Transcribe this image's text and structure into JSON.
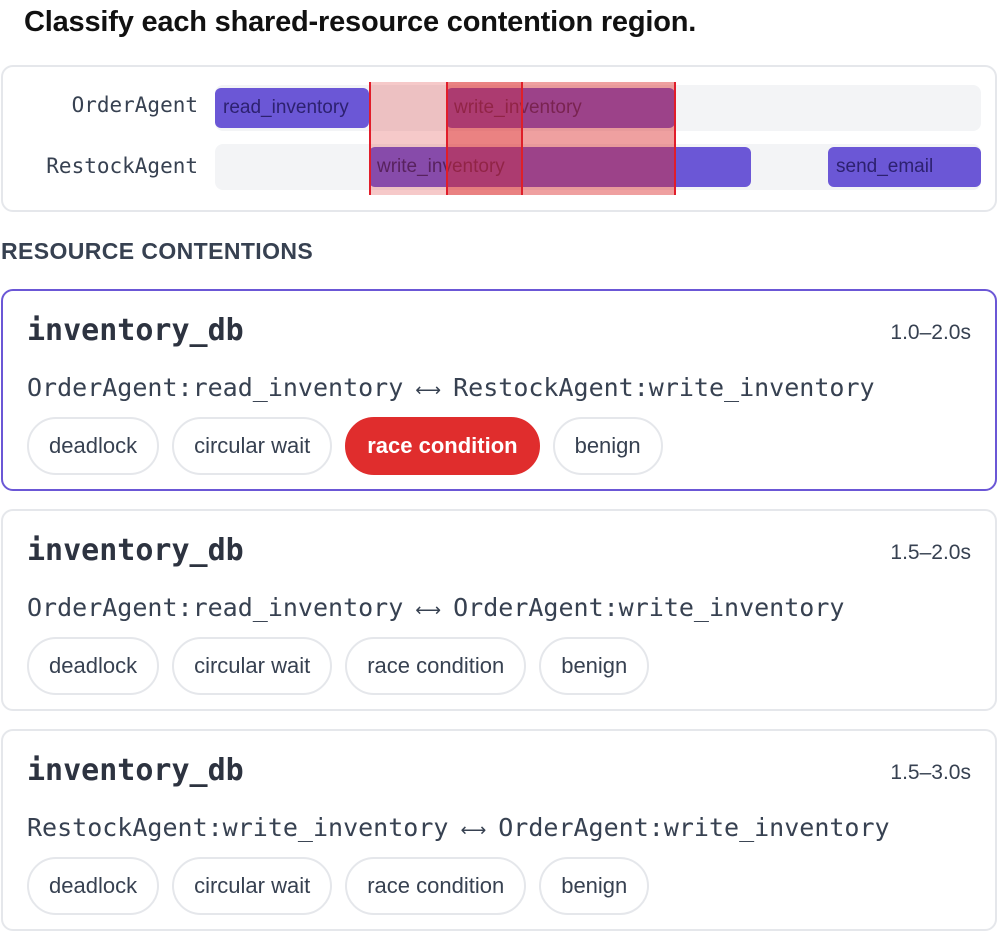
{
  "title": "Classify each shared-resource contention region.",
  "timeline": {
    "lanes": [
      {
        "label": "OrderAgent",
        "bars": [
          "read_inventory",
          "write_inventory"
        ]
      },
      {
        "label": "RestockAgent",
        "bars": [
          "write_inventory",
          "send_email"
        ]
      }
    ]
  },
  "section_heading": "RESOURCE CONTENTIONS",
  "contentions": [
    {
      "resource": "inventory_db",
      "time": "1.0–2.0s",
      "left": "OrderAgent:read_inventory",
      "arrow": "⟷",
      "right": "RestockAgent:write_inventory",
      "selected": "race condition"
    },
    {
      "resource": "inventory_db",
      "time": "1.5–2.0s",
      "left": "OrderAgent:read_inventory",
      "arrow": "⟷",
      "right": "OrderAgent:write_inventory",
      "selected": ""
    },
    {
      "resource": "inventory_db",
      "time": "1.5–3.0s",
      "left": "RestockAgent:write_inventory",
      "arrow": "⟷",
      "right": "OrderAgent:write_inventory",
      "selected": ""
    }
  ],
  "options": [
    "deadlock",
    "circular wait",
    "race condition",
    "benign"
  ],
  "colors": {
    "accent": "#6b57d6",
    "selected": "#e02d2d",
    "overlay": "#e11d2a"
  }
}
